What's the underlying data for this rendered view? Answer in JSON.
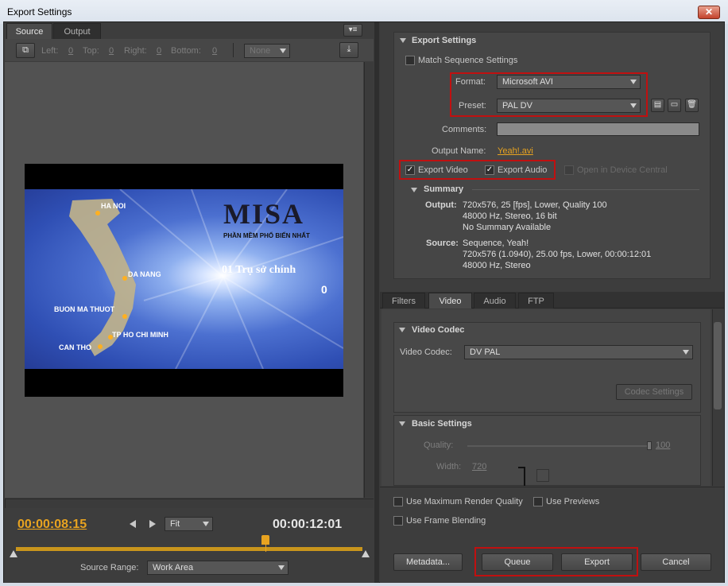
{
  "window": {
    "title": "Export Settings",
    "close": "✕"
  },
  "left": {
    "tabs": [
      "Source",
      "Output"
    ],
    "crop": {
      "left_label": "Left:",
      "left": "0",
      "top_label": "Top:",
      "top": "0",
      "right_label": "Right:",
      "right": "0",
      "bottom_label": "Bottom:",
      "bottom": "0",
      "ratio": "None"
    },
    "video": {
      "brand": "MISA",
      "brand_tag": "PHẦN MỀM PHỔ BIẾN NHẤT",
      "caption": "01 Trụ sở chính",
      "caption_num": "0",
      "cities": [
        "HA NOI",
        "DA NANG",
        "BUON MA THUOT",
        "TP HO CHI MINH",
        "CAN THO"
      ]
    },
    "timecode_current": "00:00:08:15",
    "timecode_total": "00:00:12:01",
    "zoom": "Fit",
    "source_range_label": "Source Range:",
    "source_range": "Work Area",
    "playhead_fraction": 0.72
  },
  "right": {
    "export_settings": {
      "title": "Export Settings",
      "match": "Match Sequence Settings",
      "format_label": "Format:",
      "format": "Microsoft AVI",
      "preset_label": "Preset:",
      "preset": "PAL DV",
      "comments_label": "Comments:",
      "comments": "",
      "output_name_label": "Output Name:",
      "output_name": "Yeah!.avi",
      "export_video": "Export Video",
      "export_audio": "Export Audio",
      "device_central": "Open in Device Central"
    },
    "summary": {
      "title": "Summary",
      "output_label": "Output:",
      "output_lines": [
        "720x576, 25 [fps], Lower, Quality 100",
        "48000 Hz, Stereo, 16 bit",
        "No Summary Available"
      ],
      "source_label": "Source:",
      "source_lines": [
        "Sequence, Yeah!",
        "720x576 (1.0940), 25.00 fps, Lower, 00:00:12:01",
        "48000 Hz, Stereo"
      ]
    },
    "tabs": [
      "Filters",
      "Video",
      "Audio",
      "FTP"
    ],
    "video_codec": {
      "title": "Video Codec",
      "label": "Video Codec:",
      "value": "DV PAL",
      "settings_btn": "Codec Settings"
    },
    "basic": {
      "title": "Basic Settings",
      "quality_label": "Quality:",
      "quality": "100",
      "width_label": "Width:",
      "width": "720"
    },
    "options": {
      "max_render": "Use Maximum Render Quality",
      "previews": "Use Previews",
      "frame_blending": "Use Frame Blending"
    },
    "buttons": {
      "metadata": "Metadata...",
      "queue": "Queue",
      "export": "Export",
      "cancel": "Cancel"
    }
  },
  "colors": {
    "accent": "#e8a320",
    "highlight": "#c01010"
  }
}
